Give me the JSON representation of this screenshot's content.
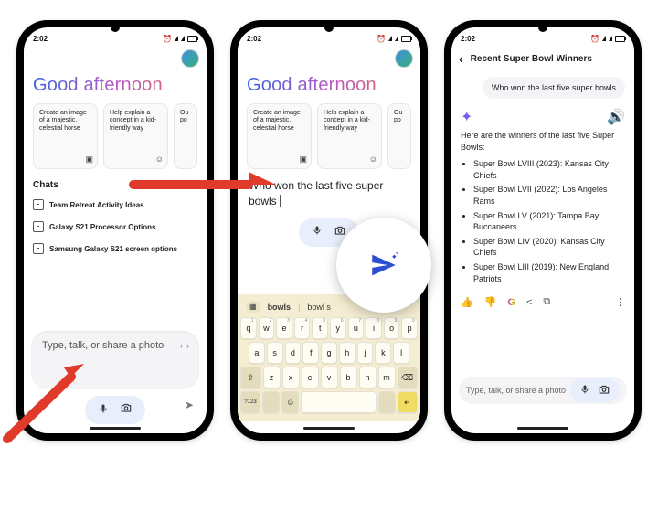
{
  "status": {
    "time": "2:02",
    "alarm_icon": "alarm-icon"
  },
  "greeting": "Good afternoon",
  "suggestion_cards": [
    {
      "text": "Create an image of a majestic, celestial horse",
      "corner_icon": "image-icon"
    },
    {
      "text": "Help explain a concept in a kid-friendly way",
      "corner_icon": "smile-icon"
    },
    {
      "text_peek": "Ou\npo"
    }
  ],
  "chats": {
    "label": "Chats",
    "items": [
      "Team Retreat Activity Ideas",
      "Galaxy S21 Processor Options",
      "Samsung Galaxy S21 screen options"
    ]
  },
  "composer": {
    "placeholder": "Type, talk, or share a photo"
  },
  "typed_query": "Who won the last five super bowls",
  "typed_line1": "Who won the last five super",
  "typed_line2": "bowls",
  "keyboard": {
    "sug1": "bowls",
    "sug2": "bowl s",
    "row1": [
      "q",
      "w",
      "e",
      "r",
      "t",
      "y",
      "u",
      "i",
      "o",
      "p"
    ],
    "row1_sup": [
      "1",
      "2",
      "3",
      "4",
      "5",
      "6",
      "7",
      "8",
      "9",
      "0"
    ],
    "row2": [
      "a",
      "s",
      "d",
      "f",
      "g",
      "h",
      "j",
      "k",
      "l"
    ],
    "row3_mid": [
      "z",
      "x",
      "c",
      "v",
      "b",
      "n",
      "m"
    ],
    "shift": "⇧",
    "backspace": "⌫",
    "numkey": "?123",
    "comma": ",",
    "emoji": "☺",
    "period": ".",
    "enter": "↵"
  },
  "response": {
    "header": "Recent Super Bowl Winners",
    "user_msg": "Who won the last five super bowls",
    "intro": "Here are the winners of the last five Super Bowls:",
    "items": [
      "Super Bowl LVIII (2023): Kansas City Chiefs",
      "Super Bowl LVII (2022): Los Angeles Rams",
      "Super Bowl LV (2021): Tampa Bay Buccaneers",
      "Super Bowl LIV (2020): Kansas City Chiefs",
      "Super Bowl LIII (2019): New England Patriots"
    ]
  }
}
